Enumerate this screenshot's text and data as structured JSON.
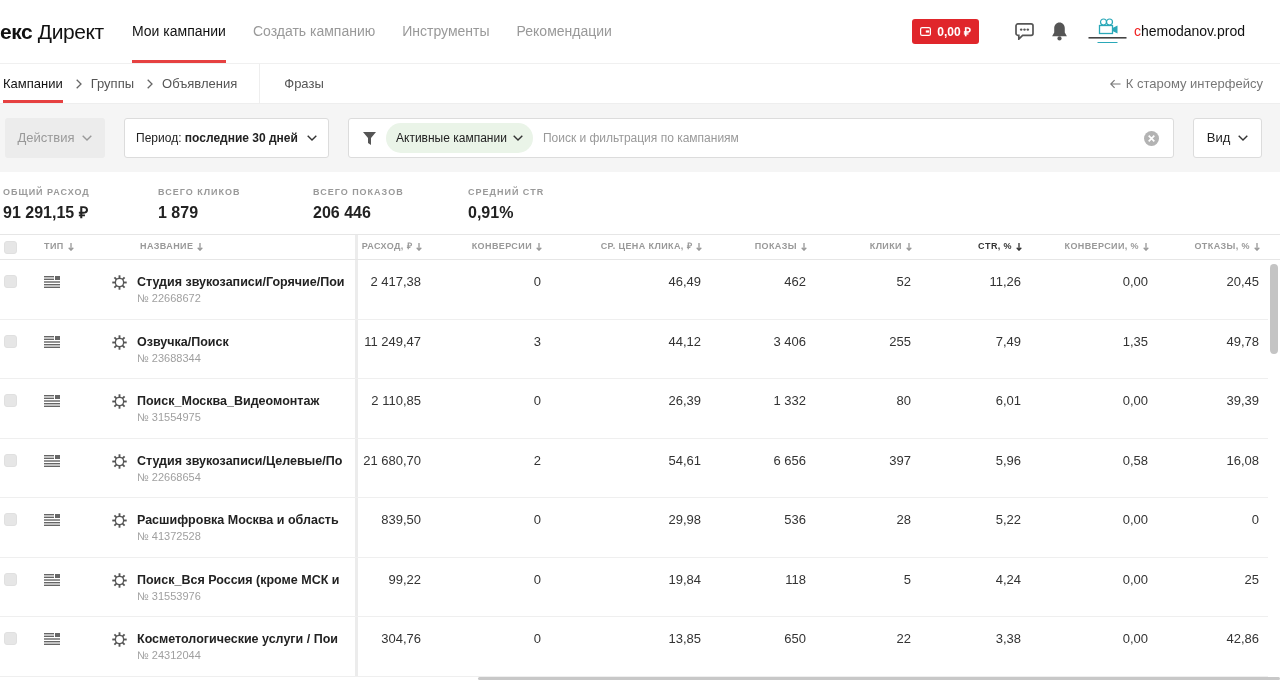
{
  "header": {
    "logo": {
      "brand": "екс",
      "product": "Директ"
    },
    "nav": [
      {
        "label": "Мои кампании",
        "selected": true
      },
      {
        "label": "Создать кампанию",
        "selected": false
      },
      {
        "label": "Инструменты",
        "selected": false
      },
      {
        "label": "Рекомендации",
        "selected": false
      }
    ],
    "balance": "0,00 ₽",
    "username": {
      "accent": "c",
      "rest": "hemodanov.prod"
    }
  },
  "subnav": {
    "breadcrumbs": [
      {
        "label": "Кампании",
        "selected": true
      },
      {
        "label": "Группы",
        "selected": false
      },
      {
        "label": "Объявления",
        "selected": false
      }
    ],
    "tabs": [
      {
        "label": "Фразы",
        "selected": false
      }
    ],
    "back_link": "К старому интерфейсу"
  },
  "toolbar": {
    "actions": {
      "label": "Действия",
      "disabled": true
    },
    "period": {
      "label": "Период:",
      "value": "последние 30 дней"
    },
    "filter": {
      "chip": "Активные кампании",
      "placeholder": "Поиск и фильтрация по кампаниям"
    },
    "view": "Вид"
  },
  "stats": [
    {
      "label": "ОБЩИЙ РАСХОД",
      "value": "91 291,15 ₽"
    },
    {
      "label": "ВСЕГО КЛИКОВ",
      "value": "1 879"
    },
    {
      "label": "ВСЕГО ПОКАЗОВ",
      "value": "206 446"
    },
    {
      "label": "СРЕДНИЙ CTR",
      "value": "0,91%"
    }
  ],
  "table": {
    "select_all": {
      "checked": false
    },
    "fixed_columns": [
      {
        "label": "ТИП",
        "selected": false
      },
      {
        "label": "НАЗВАНИЕ",
        "selected": false
      }
    ],
    "columns": [
      {
        "label": "РАСХОД, ₽",
        "selected": false
      },
      {
        "label": "КОНВЕРСИИ",
        "selected": false
      },
      {
        "label": "СР. ЦЕНА КЛИКА, ₽",
        "selected": false
      },
      {
        "label": "ПОКАЗЫ",
        "selected": false
      },
      {
        "label": "КЛИКИ",
        "selected": false
      },
      {
        "label": "CTR, %",
        "selected": true
      },
      {
        "label": "КОНВЕРСИИ, %",
        "selected": false
      },
      {
        "label": "ОТКАЗЫ, %",
        "selected": false
      }
    ],
    "rows": [
      {
        "checked": false,
        "name": "Студия звукозаписи/Горячие/Пои",
        "number": "№ 22668672",
        "cells": [
          "2 417,38",
          "0",
          "46,49",
          "462",
          "52",
          "11,26",
          "0,00",
          "20,45"
        ]
      },
      {
        "checked": false,
        "name": "Озвучка/Поиск",
        "number": "№ 23688344",
        "cells": [
          "11 249,47",
          "3",
          "44,12",
          "3 406",
          "255",
          "7,49",
          "1,35",
          "49,78"
        ]
      },
      {
        "checked": false,
        "name": "Поиск_Москва_Видеомонтаж",
        "number": "№ 31554975",
        "cells": [
          "2 110,85",
          "0",
          "26,39",
          "1 332",
          "80",
          "6,01",
          "0,00",
          "39,39"
        ]
      },
      {
        "checked": false,
        "name": "Студия звукозаписи/Целевые/По",
        "number": "№ 22668654",
        "cells": [
          "21 680,70",
          "2",
          "54,61",
          "6 656",
          "397",
          "5,96",
          "0,58",
          "16,08"
        ]
      },
      {
        "checked": false,
        "name": "Расшифровка Москва и область",
        "number": "№ 41372528",
        "cells": [
          "839,50",
          "0",
          "29,98",
          "536",
          "28",
          "5,22",
          "0,00",
          "0"
        ]
      },
      {
        "checked": false,
        "name": "Поиск_Вся Россия (кроме МСК и",
        "number": "№ 31553976",
        "cells": [
          "99,22",
          "0",
          "19,84",
          "118",
          "5",
          "4,24",
          "0,00",
          "25"
        ]
      },
      {
        "checked": false,
        "name": "Косметологические услуги / Пои",
        "number": "№ 24312044",
        "cells": [
          "304,76",
          "0",
          "13,85",
          "650",
          "22",
          "3,38",
          "0,00",
          "42,86"
        ]
      }
    ]
  }
}
